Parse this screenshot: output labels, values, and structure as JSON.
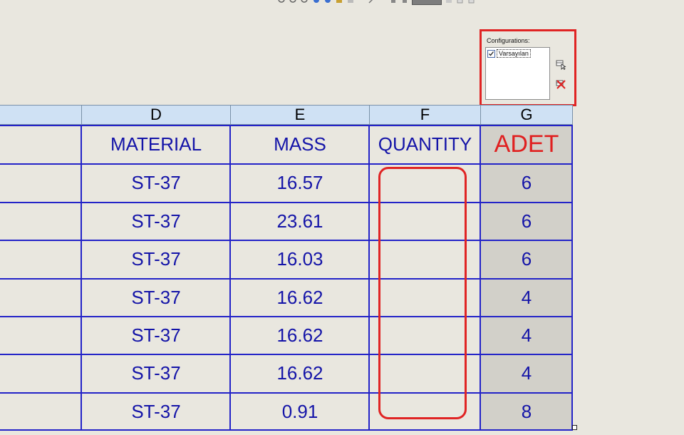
{
  "configurations": {
    "title": "Configurations:",
    "items": [
      {
        "label": "Varsayılan",
        "checked": true
      }
    ]
  },
  "table": {
    "column_letters": [
      "D",
      "E",
      "F",
      "G"
    ],
    "headers": [
      "MATERIAL",
      "MASS",
      "QUANTITY",
      "ADET"
    ],
    "rows": [
      {
        "material": "ST-37",
        "mass": "16.57",
        "quantity": "",
        "adet": "6"
      },
      {
        "material": "ST-37",
        "mass": "23.61",
        "quantity": "",
        "adet": "6"
      },
      {
        "material": "ST-37",
        "mass": "16.03",
        "quantity": "",
        "adet": "6"
      },
      {
        "material": "ST-37",
        "mass": "16.62",
        "quantity": "",
        "adet": "4"
      },
      {
        "material": "ST-37",
        "mass": "16.62",
        "quantity": "",
        "adet": "4"
      },
      {
        "material": "ST-37",
        "mass": "16.62",
        "quantity": "",
        "adet": "4"
      },
      {
        "material": "ST-37",
        "mass": "0.91",
        "quantity": "",
        "adet": "8"
      }
    ]
  },
  "colors": {
    "grid_line": "#2323c8",
    "text": "#1414a8",
    "adet_header": "#e02020",
    "highlight": "#e02424",
    "column_header_bg": "#cfe1f4",
    "g_column_bg": "#d2d0c9",
    "background": "#e9e7df"
  }
}
